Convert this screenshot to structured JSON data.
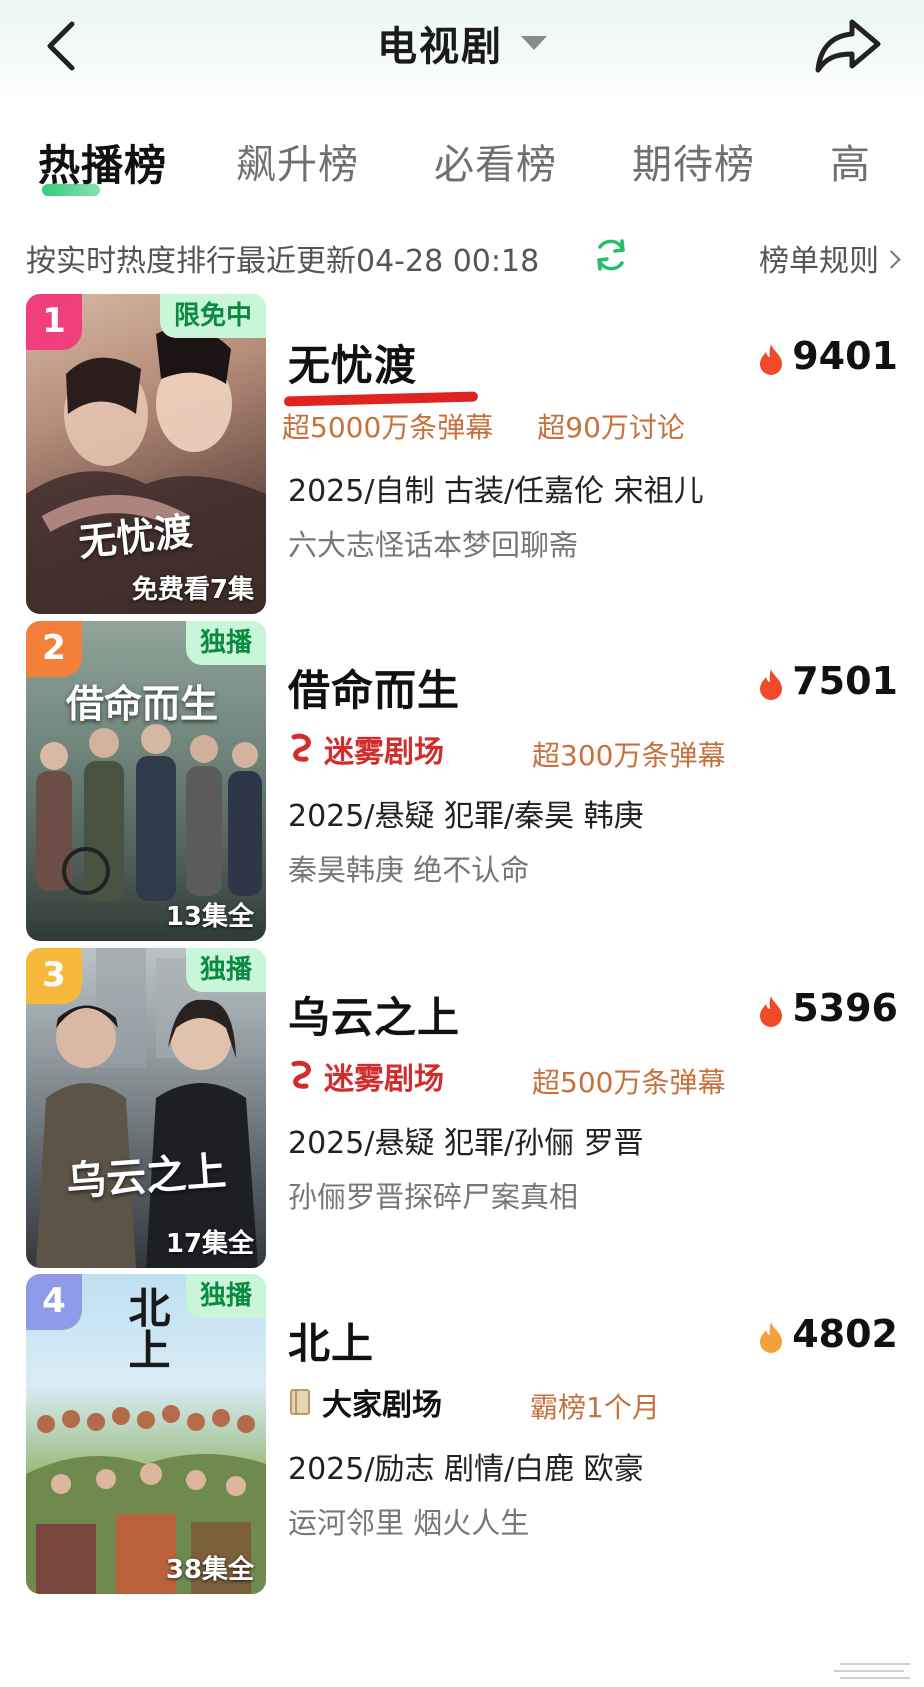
{
  "header": {
    "title": "电视剧"
  },
  "tabs": [
    {
      "label": "热播榜"
    },
    {
      "label": "飙升榜"
    },
    {
      "label": "必看榜"
    },
    {
      "label": "期待榜"
    },
    {
      "label": "高"
    }
  ],
  "info": {
    "update_text": "按实时热度排行最近更新04-28 00:18",
    "rules_label": "榜单规则"
  },
  "items": [
    {
      "rank": "1",
      "tag": "限免中",
      "episodes": "免费看7集",
      "poster_title": "无忧渡",
      "title": "无忧渡",
      "heat": "9401",
      "tags": [
        "超5000万条弹幕",
        "超90万讨论"
      ],
      "meta": "2025/自制 古装/任嘉伦 宋祖儿",
      "desc": "六大志怪话本梦回聊斋"
    },
    {
      "rank": "2",
      "tag": "独播",
      "episodes": "13集全",
      "poster_title": "借命而生",
      "title": "借命而生",
      "heat": "7501",
      "theater": "迷雾剧场",
      "tags": [
        "超300万条弹幕"
      ],
      "meta": "2025/悬疑 犯罪/秦昊 韩庚",
      "desc": "秦昊韩庚 绝不认命"
    },
    {
      "rank": "3",
      "tag": "独播",
      "episodes": "17集全",
      "poster_title": "乌云之上",
      "title": "乌云之上",
      "heat": "5396",
      "theater": "迷雾剧场",
      "tags": [
        "超500万条弹幕"
      ],
      "meta": "2025/悬疑 犯罪/孙俪 罗晋",
      "desc": "孙俪罗晋探碎尸案真相"
    },
    {
      "rank": "4",
      "tag": "独播",
      "episodes": "38集全",
      "poster_title": "北上",
      "title": "北上",
      "heat": "4802",
      "theater": "大家剧场",
      "tags": [
        "霸榜1个月"
      ],
      "meta": "2025/励志 剧情/白鹿 欧豪",
      "desc": "运河邻里 烟火人生"
    }
  ],
  "colors": {
    "accent_green": "#20c56f",
    "tag_orange": "#c7713e",
    "theater_red": "#d22c2c",
    "flame_red": "#f04a2a",
    "flame_orange": "#f6a03a",
    "rank1": "#ef3f7d",
    "rank2": "#f3803a",
    "rank3": "#f6b93b",
    "rank4": "#8f9be8"
  },
  "icons": {
    "back": "chevron-left-icon",
    "share": "share-arrow-icon",
    "refresh": "refresh-icon",
    "heat": "flame-icon"
  }
}
